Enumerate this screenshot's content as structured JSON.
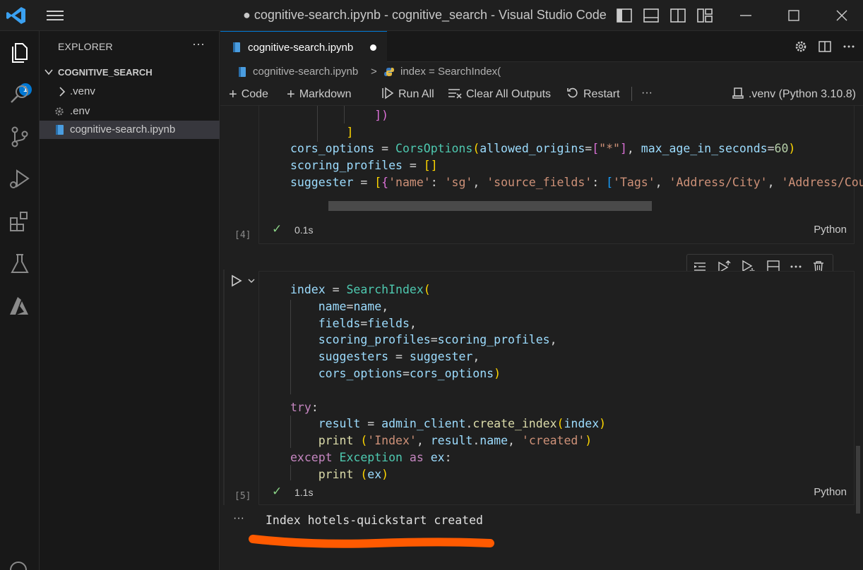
{
  "titlebar": {
    "title": "● cognitive-search.ipynb - cognitive_search - Visual Studio Code"
  },
  "activity": {
    "badge_count": "1"
  },
  "sidebar": {
    "title": "EXPLORER",
    "more": "···",
    "folder": "COGNITIVE_SEARCH",
    "items": [
      {
        "label": ".venv",
        "icon": "chevron-right-icon"
      },
      {
        "label": ".env",
        "icon": "gear-icon"
      },
      {
        "label": "cognitive-search.ipynb",
        "icon": "notebook-icon"
      }
    ]
  },
  "tabs": [
    {
      "label": "cognitive-search.ipynb",
      "modified": true
    }
  ],
  "breadcrumb": {
    "file": "cognitive-search.ipynb",
    "separator": ">",
    "symbol": "index = SearchIndex("
  },
  "toolbar": {
    "code": "Code",
    "markdown": "Markdown",
    "run_all": "Run All",
    "clear_outputs": "Clear All Outputs",
    "restart": "Restart",
    "more": "···",
    "kernel": ".venv (Python 3.10.8)"
  },
  "cells": [
    {
      "exec_count": "[4]",
      "time": "0.1s",
      "language": "Python"
    },
    {
      "exec_count": "[5]",
      "time": "1.1s",
      "language": "Python"
    }
  ],
  "output": {
    "more": "···",
    "text": "Index hotels-quickstart created"
  },
  "colors": {
    "accent": "#0078d4",
    "success": "#89d185",
    "annotation": "#ff5a00"
  }
}
